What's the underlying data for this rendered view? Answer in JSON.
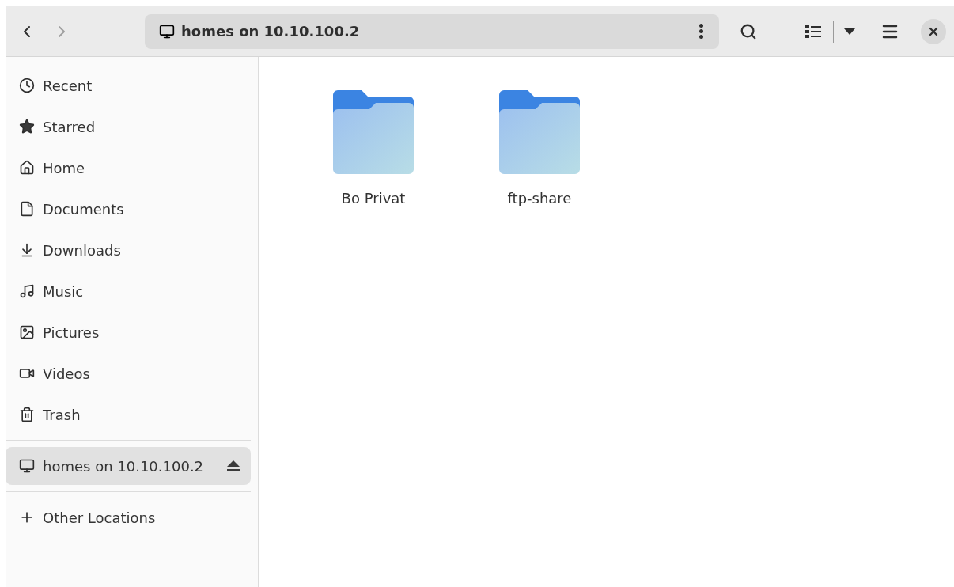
{
  "header": {
    "location": "homes on 10.10.100.2"
  },
  "sidebar": {
    "places": [
      {
        "label": "Recent",
        "selected": false
      },
      {
        "label": "Starred",
        "selected": false
      },
      {
        "label": "Home",
        "selected": false
      },
      {
        "label": "Documents",
        "selected": false
      },
      {
        "label": "Downloads",
        "selected": false
      },
      {
        "label": "Music",
        "selected": false
      },
      {
        "label": "Pictures",
        "selected": false
      },
      {
        "label": "Videos",
        "selected": false
      },
      {
        "label": "Trash",
        "selected": false
      }
    ],
    "mounts": [
      {
        "label": "homes on 10.10.100.2",
        "selected": true
      }
    ],
    "other": [
      {
        "label": "Other Locations",
        "selected": false
      }
    ]
  },
  "files": [
    {
      "name": "Bo Privat"
    },
    {
      "name": "ftp-share"
    }
  ]
}
